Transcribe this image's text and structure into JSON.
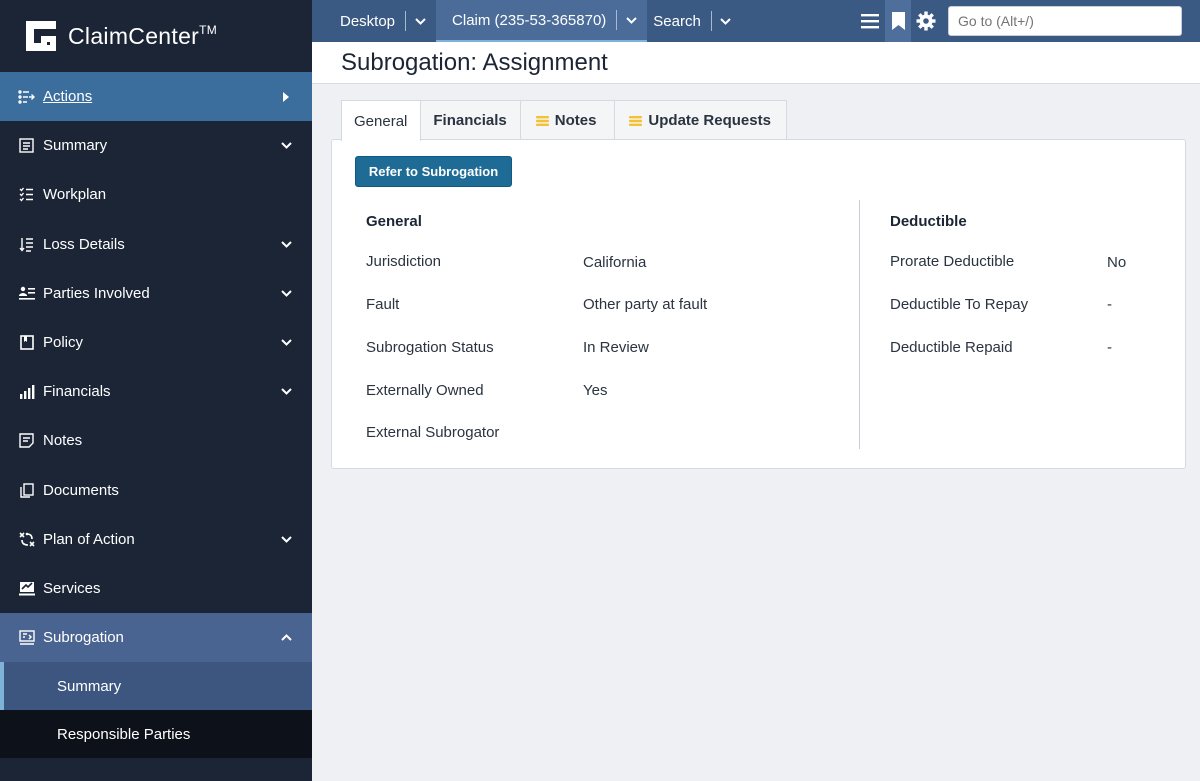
{
  "app": {
    "name": "ClaimCenter",
    "trademark": "TM"
  },
  "sidebar": {
    "actions": {
      "label": "Actions"
    },
    "items": [
      {
        "label": "Summary",
        "icon": "summary-icon",
        "expandable": true
      },
      {
        "label": "Workplan",
        "icon": "workplan-icon",
        "expandable": false
      },
      {
        "label": "Loss Details",
        "icon": "loss-details-icon",
        "expandable": true
      },
      {
        "label": "Parties Involved",
        "icon": "parties-icon",
        "expandable": true
      },
      {
        "label": "Policy",
        "icon": "policy-icon",
        "expandable": true
      },
      {
        "label": "Financials",
        "icon": "financials-icon",
        "expandable": true
      },
      {
        "label": "Notes",
        "icon": "notes-icon",
        "expandable": false
      },
      {
        "label": "Documents",
        "icon": "documents-icon",
        "expandable": false
      },
      {
        "label": "Plan of Action",
        "icon": "plan-of-action-icon",
        "expandable": true
      },
      {
        "label": "Services",
        "icon": "services-icon",
        "expandable": false
      }
    ],
    "subrogation": {
      "label": "Subrogation",
      "children": [
        "Summary",
        "Responsible Parties"
      ]
    }
  },
  "topbar": {
    "desktop": "Desktop",
    "claim": "Claim (235-53-365870)",
    "search": "Search",
    "goto_placeholder": "Go to (Alt+/)"
  },
  "page": {
    "title": "Subrogation: Assignment"
  },
  "tabs": [
    {
      "label": "General",
      "active": true,
      "icon": ""
    },
    {
      "label": "Financials",
      "active": false,
      "icon": ""
    },
    {
      "label": "Notes",
      "active": false,
      "icon": "notes-stack-icon"
    },
    {
      "label": "Update Requests",
      "active": false,
      "icon": "requests-stack-icon"
    }
  ],
  "card": {
    "refer_button": "Refer to Subrogation",
    "general": {
      "heading": "General",
      "fields": [
        {
          "label": "Jurisdiction",
          "value": "California"
        },
        {
          "label": "Fault",
          "value": "Other party at fault"
        },
        {
          "label": "Subrogation Status",
          "value": "In Review"
        },
        {
          "label": "Externally Owned",
          "value": "Yes"
        },
        {
          "label": "External Subrogator",
          "value": ""
        }
      ]
    },
    "deductible": {
      "heading": "Deductible",
      "fields": [
        {
          "label": "Prorate Deductible",
          "value": "No"
        },
        {
          "label": "Deductible To Repay",
          "value": "-"
        },
        {
          "label": "Deductible Repaid",
          "value": "-"
        }
      ]
    }
  },
  "colors": {
    "sidebar_bg": "#1b2536",
    "actions_bg": "#3b6d9d",
    "subro_bg": "#4a6491",
    "topbar_bg": "#3b5a83",
    "button_bg": "#1e6b96",
    "tab_icon": "#f3c233"
  }
}
